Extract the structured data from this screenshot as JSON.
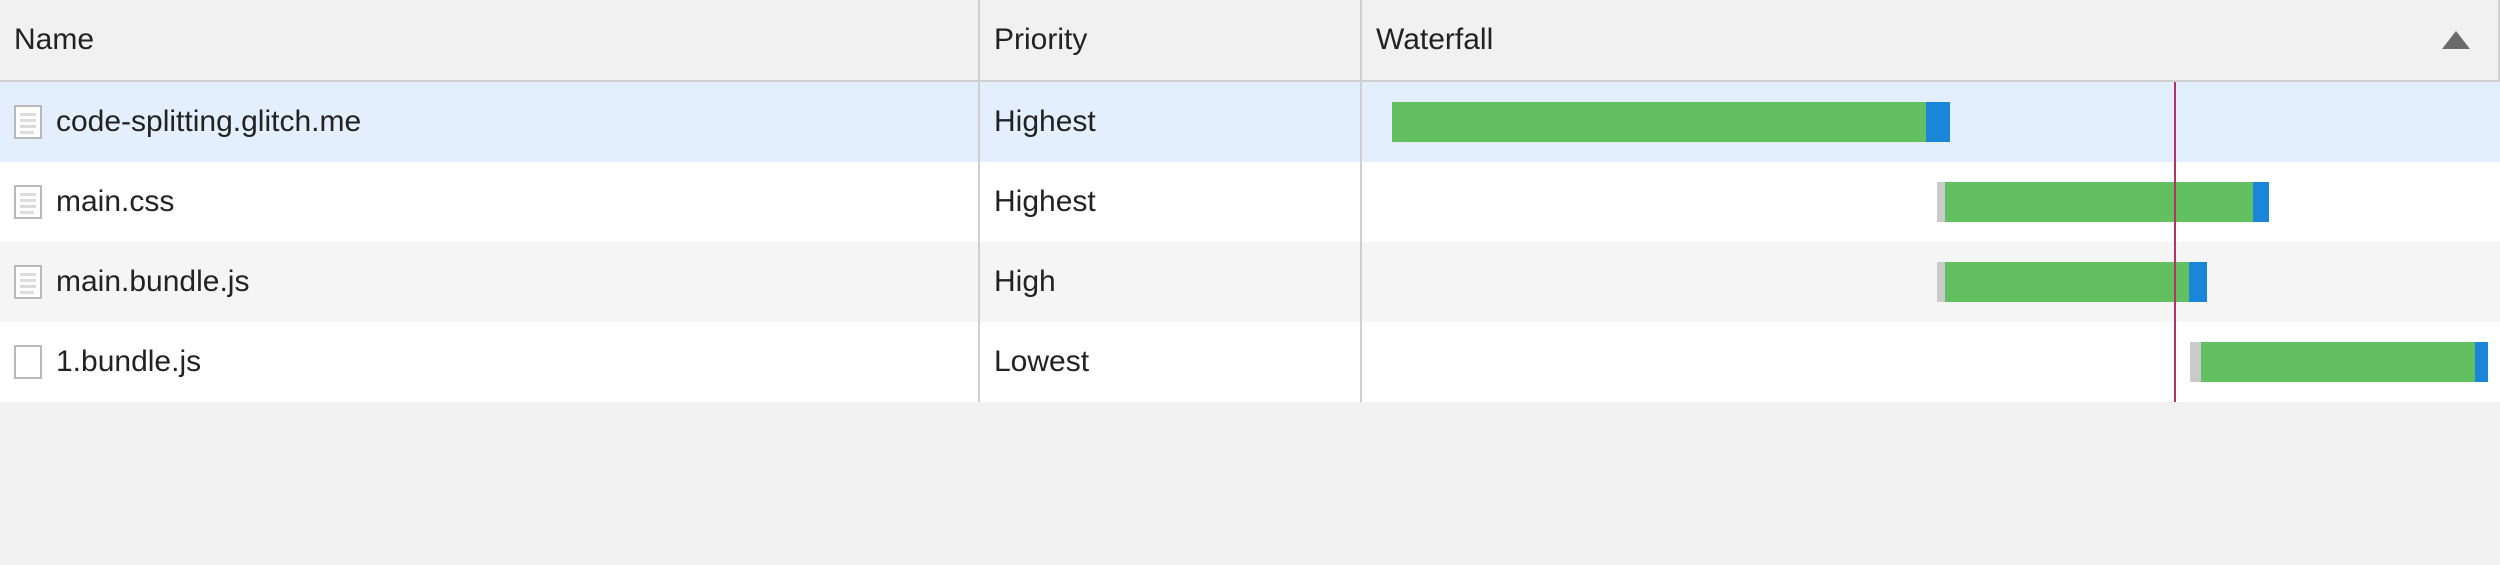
{
  "columns": {
    "name": "Name",
    "priority": "Priority",
    "waterfall": "Waterfall"
  },
  "sort": {
    "column": "waterfall",
    "direction": "asc"
  },
  "marker_percent": 71.5,
  "rows": [
    {
      "name": "code-splitting.glitch.me",
      "priority": "Highest",
      "icon": "doc",
      "selected": true,
      "waterfall": {
        "start_pct": 0.5,
        "wait_pct": 0,
        "main_pct": 48.5,
        "tail_pct": 2.2
      }
    },
    {
      "name": "main.css",
      "priority": "Highest",
      "icon": "doc",
      "selected": false,
      "waterfall": {
        "start_pct": 50.0,
        "wait_pct": 0.7,
        "main_pct": 28.0,
        "tail_pct": 1.4
      }
    },
    {
      "name": "main.bundle.js",
      "priority": "High",
      "icon": "doc",
      "selected": false,
      "waterfall": {
        "start_pct": 50.0,
        "wait_pct": 0.7,
        "main_pct": 22.2,
        "tail_pct": 1.6
      }
    },
    {
      "name": "1.bundle.js",
      "priority": "Lowest",
      "icon": "blank",
      "selected": false,
      "waterfall": {
        "start_pct": 73.0,
        "wait_pct": 1.0,
        "main_pct": 24.8,
        "tail_pct": 1.2
      }
    }
  ]
}
